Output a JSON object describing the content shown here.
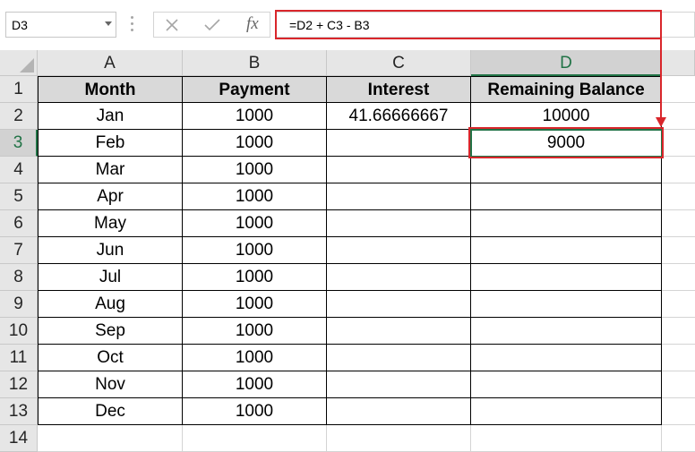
{
  "formula_bar": {
    "name_box": "D3",
    "cancel_icon": "close-icon",
    "enter_icon": "check-icon",
    "fx_label": "fx",
    "formula": "=D2 + C3 - B3"
  },
  "columns": [
    "A",
    "B",
    "C",
    "D"
  ],
  "row_numbers": [
    "1",
    "2",
    "3",
    "4",
    "5",
    "6",
    "7",
    "8",
    "9",
    "10",
    "11",
    "12",
    "13",
    "14"
  ],
  "table": {
    "headers": [
      "Month",
      "Payment",
      "Interest",
      "Remaining Balance"
    ],
    "rows": [
      {
        "month": "Jan",
        "payment": "1000",
        "interest": "41.66666667",
        "balance": "10000"
      },
      {
        "month": "Feb",
        "payment": "1000",
        "interest": "",
        "balance": "9000"
      },
      {
        "month": "Mar",
        "payment": "1000",
        "interest": "",
        "balance": ""
      },
      {
        "month": "Apr",
        "payment": "1000",
        "interest": "",
        "balance": ""
      },
      {
        "month": "May",
        "payment": "1000",
        "interest": "",
        "balance": ""
      },
      {
        "month": "Jun",
        "payment": "1000",
        "interest": "",
        "balance": ""
      },
      {
        "month": "Jul",
        "payment": "1000",
        "interest": "",
        "balance": ""
      },
      {
        "month": "Aug",
        "payment": "1000",
        "interest": "",
        "balance": ""
      },
      {
        "month": "Sep",
        "payment": "1000",
        "interest": "",
        "balance": ""
      },
      {
        "month": "Oct",
        "payment": "1000",
        "interest": "",
        "balance": ""
      },
      {
        "month": "Nov",
        "payment": "1000",
        "interest": "",
        "balance": ""
      },
      {
        "month": "Dec",
        "payment": "1000",
        "interest": "",
        "balance": ""
      }
    ]
  },
  "selection": {
    "column": "D",
    "row": "3"
  },
  "colors": {
    "highlight_red": "#d9262b",
    "excel_green": "#217346",
    "header_fill": "#d9d9d9"
  }
}
